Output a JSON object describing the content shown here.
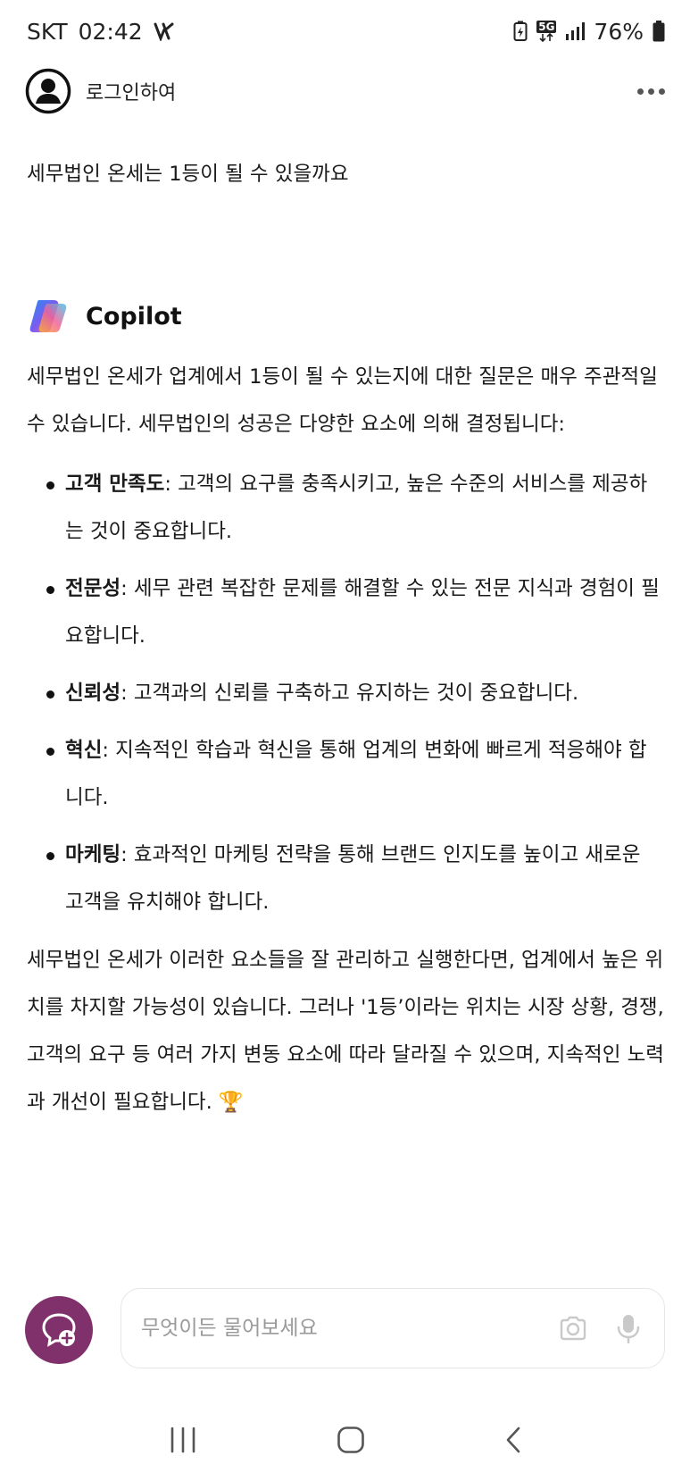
{
  "status_bar": {
    "carrier": "SKT",
    "time": "02:42",
    "network": "5G",
    "battery": "76%"
  },
  "header": {
    "login_label": "로그인하여"
  },
  "chat": {
    "user_message": "세무법인 온세는 1등이 될 수 있을까요",
    "assistant_name": "Copilot",
    "answer_intro": "세무법인 온세가 업계에서 1등이 될 수 있는지에 대한 질문은 매우 주관적일 수 있습니다. 세무법인의 성공은 다양한 요소에 의해 결정됩니다:",
    "factors": [
      {
        "title": "고객 만족도",
        "text": ": 고객의 요구를 충족시키고, 높은 수준의 서비스를 제공하는 것이 중요합니다."
      },
      {
        "title": "전문성",
        "text": ": 세무 관련 복잡한 문제를 해결할 수 있는 전문 지식과 경험이 필요합니다."
      },
      {
        "title": "신뢰성",
        "text": ": 고객과의 신뢰를 구축하고 유지하는 것이 중요합니다."
      },
      {
        "title": "혁신",
        "text": ": 지속적인 학습과 혁신을 통해 업계의 변화에 빠르게 적응해야 합니다."
      },
      {
        "title": "마케팅",
        "text": ": 효과적인 마케팅 전략을 통해 브랜드 인지도를 높이고 새로운 고객을 유치해야 합니다."
      }
    ],
    "answer_conclusion": "세무법인 온세가 이러한 요소들을 잘 관리하고 실행한다면, 업계에서 높은 위치를 차지할 가능성이 있습니다. 그러나 '1등’이라는 위치는 시장 상황, 경쟁, 고객의 요구 등 여러 가지 변동 요소에 따라 달라질 수 있으며, 지속적인 노력과 개선이 필요합니다.",
    "trophy_emoji": "🏆"
  },
  "composer": {
    "placeholder": "무엇이든 물어보세요"
  },
  "icons": {
    "new_chat": "chat-plus-icon",
    "camera": "camera-icon",
    "mic": "microphone-icon",
    "nav_recents": "recent-apps-icon",
    "nav_home": "home-icon",
    "nav_back": "back-icon"
  },
  "colors": {
    "new_chat_button": "#80316b",
    "text": "#1a1a1a",
    "placeholder": "#9a9a9a"
  }
}
